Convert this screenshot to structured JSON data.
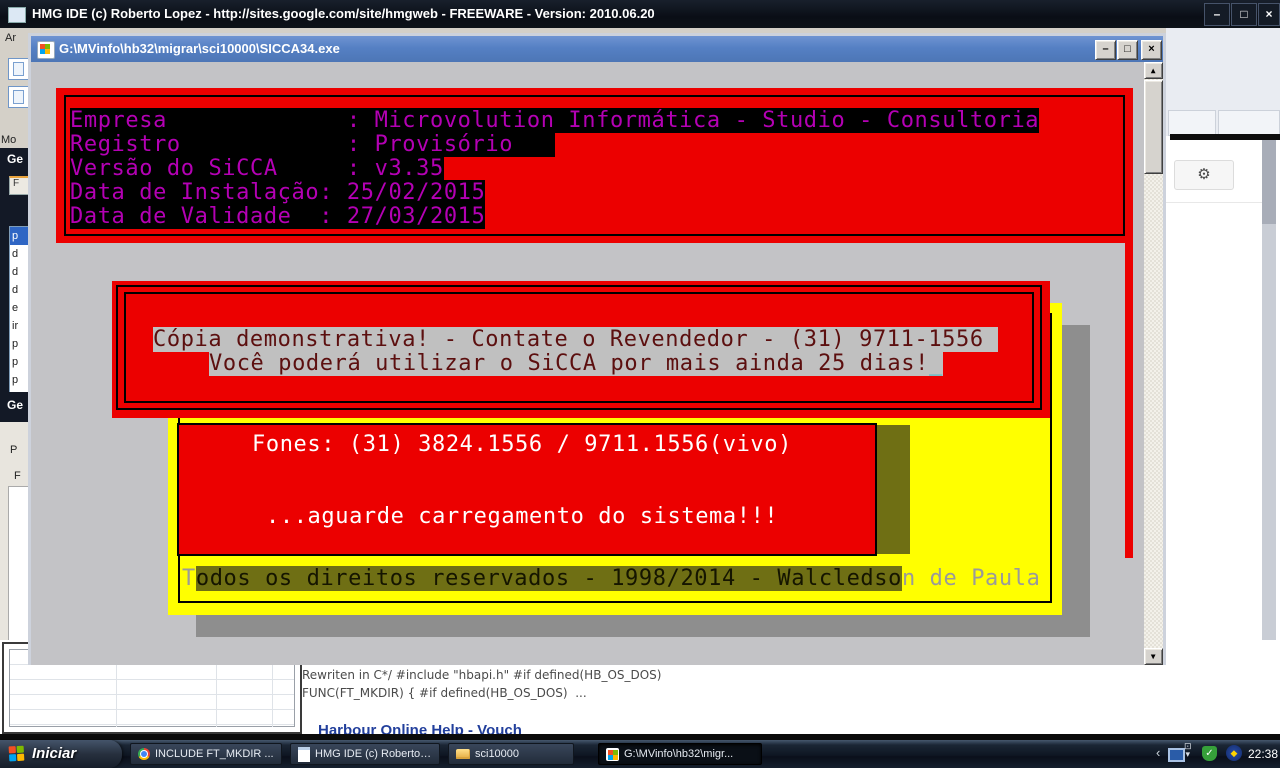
{
  "icons": {
    "minimize": "–",
    "maximize": "□",
    "close": "×",
    "scroll_up": "▲",
    "scroll_down": "▼",
    "gear": "⚙",
    "tray_expand": "‹",
    "tray_mini_top": "⊡",
    "tray_mini_bottom": "▾",
    "shield_check": "✓",
    "diamond": "◆"
  },
  "colors": {
    "dos_red": "#ec0000",
    "dos_yellow": "#ffff00",
    "dos_magenta": "#b400b4",
    "dos_silver": "#c0c0c0",
    "dos_olive": "#6f6f14",
    "shadow_gray": "#8e8e8e",
    "console_titlebar_blue": "#5580c4",
    "cursor_cyan": "#35b8c8"
  },
  "main_window": {
    "title": "HMG IDE (c) Roberto Lopez - http://sites.google.com/site/hmgweb - FREEWARE - Version: 2010.06.20"
  },
  "console_window": {
    "title": "G:\\MVinfo\\hb32\\migrar\\sci10000\\SICCA34.exe",
    "info_box": {
      "lines": [
        "Empresa             : Microvolution Informática - Studio - Consultoria",
        "Registro            : Provisório   ",
        "Versão do SiCCA     : v3.35",
        "Data de Instalação: 25/02/2015",
        "Data de Validade  : 27/03/2015"
      ]
    },
    "demo_box": {
      "line1": "Cópia demonstrativa! - Contate o Revendedor - (31) 9711-1556 ",
      "line2": "Você poderá utilizar o SiCCA por mais ainda 25 dias!",
      "cursor": "_"
    },
    "phones_box": {
      "line1": "Fones: (31) 3824.1556 / 9711.1556(vivo)",
      "line2": "...aguarde carregamento do sistema!!!"
    },
    "copyright": {
      "lead": "T",
      "highlight": "odos os direitos reservados - 1998/2014 - Walcledso",
      "tail": "n de Paula"
    }
  },
  "ide_fragments": {
    "menu_fragment": "Ar",
    "toolbar_fragment": "Mo",
    "panel1_header": "Ge",
    "panel1_tab": "F",
    "list_items": [
      "p",
      "d",
      "d",
      "d",
      "e",
      "ir",
      "p",
      "p",
      "p",
      "p"
    ],
    "panel2_header": "Ge",
    "panel3_tab": "P",
    "panel3_label": "F"
  },
  "web_page": {
    "code_line1": "Rewriten in C*/ #include \"hbapi.h\" #if defined(HB_OS_DOS)",
    "code_line2": "FUNC(FT_MKDIR) { #if defined(HB_OS_DOS)  ...",
    "link": "Harbour Online Help - Vouch"
  },
  "taskbar": {
    "start_label": "Iniciar",
    "buttons": [
      {
        "label": "INCLUDE FT_MKDIR ..."
      },
      {
        "label": "HMG IDE (c) Roberto ..."
      },
      {
        "label": "sci10000"
      },
      {
        "label": "G:\\MVinfo\\hb32\\migr..."
      }
    ],
    "clock": "22:38"
  }
}
